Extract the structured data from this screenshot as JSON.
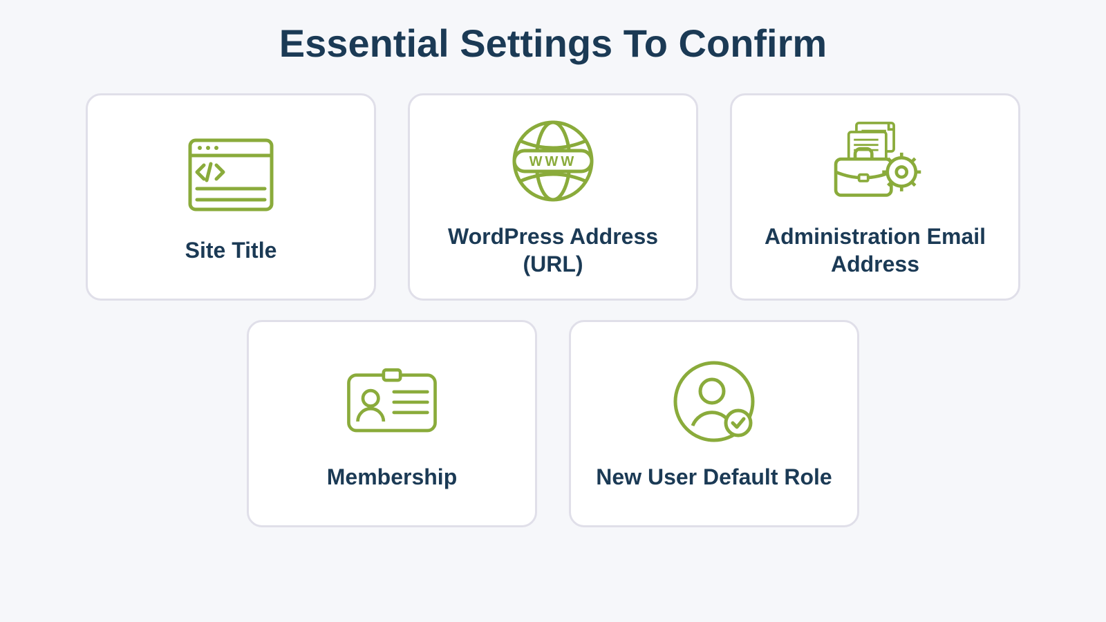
{
  "title": "Essential Settings To Confirm",
  "cards": [
    {
      "label": "Site Title",
      "icon": "code-window-icon"
    },
    {
      "label": "WordPress Address (URL)",
      "icon": "www-globe-icon"
    },
    {
      "label": "Administration Email Address",
      "icon": "briefcase-gear-icon"
    },
    {
      "label": "Membership",
      "icon": "id-card-icon"
    },
    {
      "label": "New User Default Role",
      "icon": "user-check-icon"
    }
  ],
  "colors": {
    "accent": "#8aab3b",
    "heading": "#1b3a55",
    "cardBorder": "#e0dfe9",
    "pageBg": "#f6f7fa"
  }
}
